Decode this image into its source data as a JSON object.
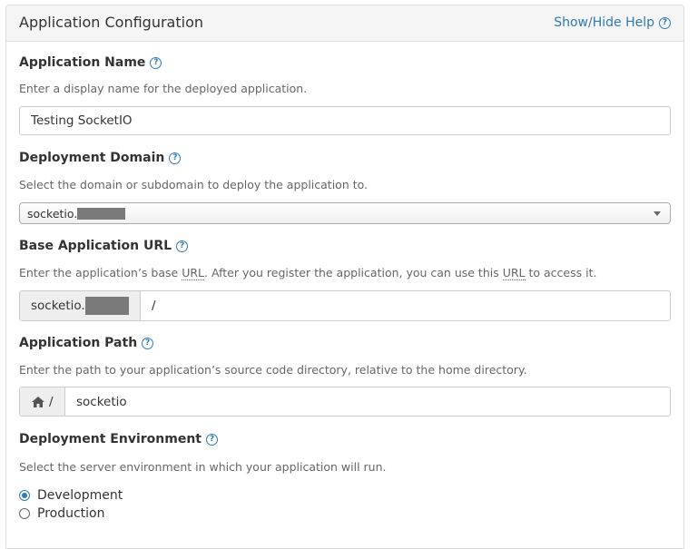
{
  "panel": {
    "title": "Application Configuration",
    "help_toggle": "Show/Hide Help",
    "help_glyph": "?"
  },
  "app_name": {
    "label": "Application Name",
    "description": "Enter a display name for the deployed application.",
    "value": "Testing SocketIO"
  },
  "domain": {
    "label": "Deployment Domain",
    "description": "Select the domain or subdomain to deploy the application to.",
    "selected_prefix": "socketio."
  },
  "base_url": {
    "label": "Base Application URL",
    "description_parts": [
      "Enter the application’s base ",
      "URL",
      ". After you register the application, you can use this ",
      "URL",
      " to access it."
    ],
    "prefix": "socketio.",
    "value": "/"
  },
  "app_path": {
    "label": "Application Path",
    "description": "Enter the path to your application’s source code directory, relative to the home directory.",
    "home_icon": "home-icon",
    "separator": "/",
    "value": "socketio"
  },
  "environment": {
    "label": "Deployment Environment",
    "description": "Select the server environment in which your application will run.",
    "options": [
      {
        "label": "Development",
        "checked": true
      },
      {
        "label": "Production",
        "checked": false
      }
    ]
  },
  "colors": {
    "accent": "#2f7ab3",
    "header_bg": "#f5f5f5",
    "addon_bg": "#eeeeee",
    "redaction": "#7a7a7a"
  }
}
